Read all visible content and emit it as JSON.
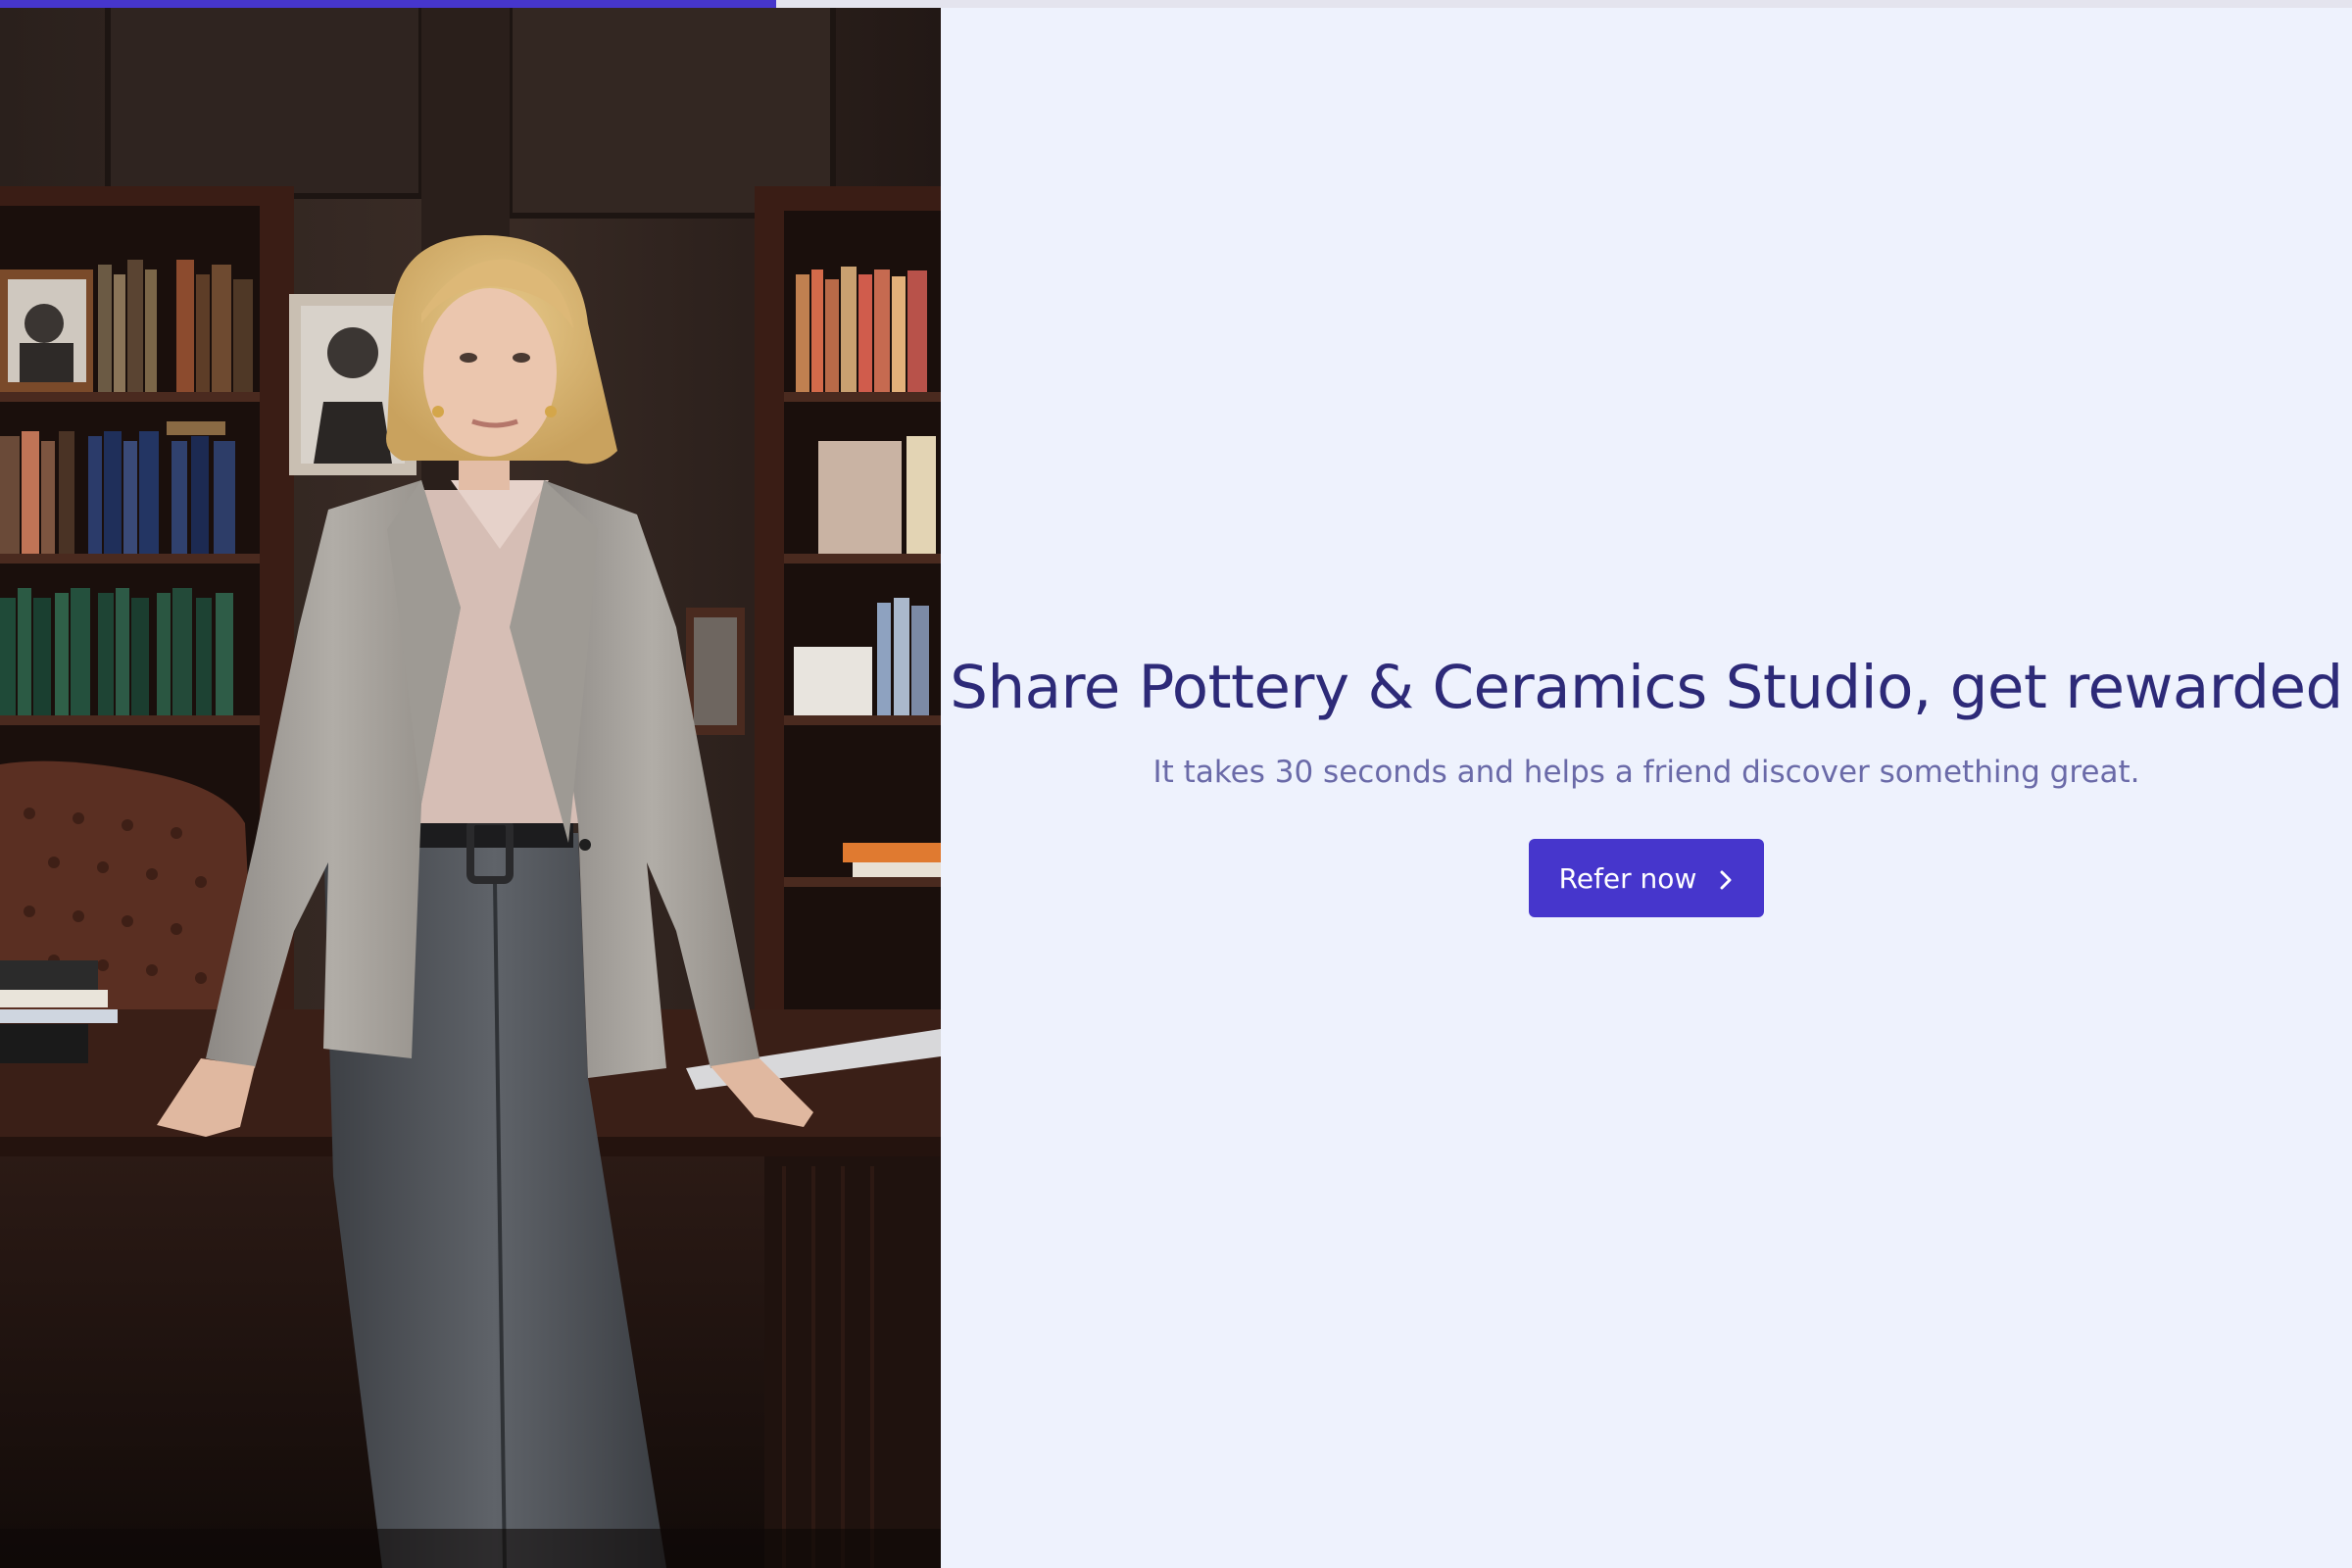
{
  "progress": {
    "percent": 33,
    "fill_color": "#4636cc",
    "track_color": "#e4e4ee"
  },
  "hero_image": {
    "subject": "woman in grey blazer standing in wood-paneled office with bookshelves"
  },
  "content": {
    "headline": "Share Pottery & Ceramics Studio, get rewarded",
    "subheadline": "It takes 30 seconds and helps a friend discover something great.",
    "cta_label": "Refer now",
    "cta_icon": "chevron-right-icon"
  },
  "colors": {
    "background": "#eef2fd",
    "headline": "#2d2a78",
    "subheadline": "#6a6aa8",
    "button": "#4636cc",
    "button_text": "#ffffff"
  }
}
